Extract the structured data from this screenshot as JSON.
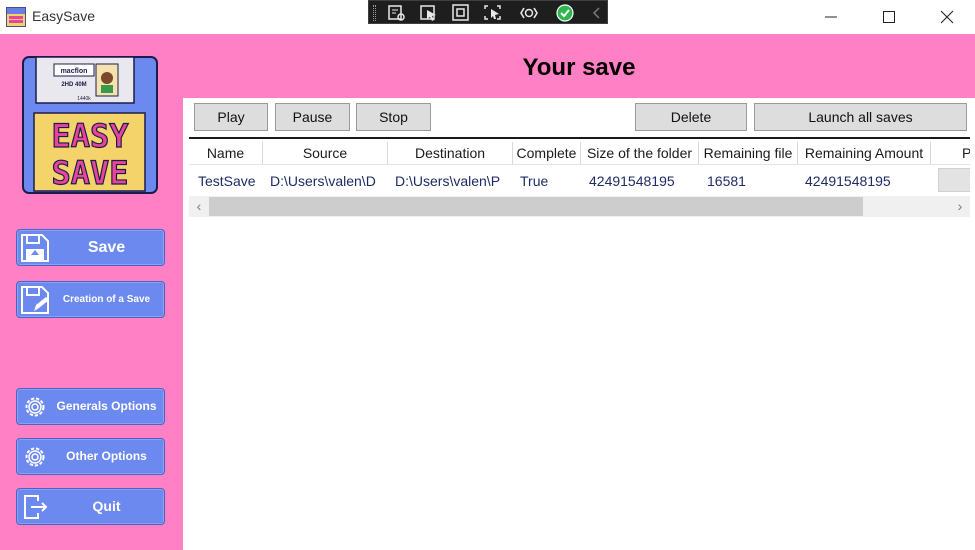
{
  "window": {
    "title": "EasySave"
  },
  "logo": {
    "text_line1": "EASY",
    "text_line2": "SAVE",
    "label_line1": "macflon",
    "label_line2": "2HD 40M",
    "label_line3": "1440k"
  },
  "sidebar": {
    "items": [
      {
        "label": "Save"
      },
      {
        "label": "Creation of a Save"
      },
      {
        "label": "Generals Options"
      },
      {
        "label": "Other Options"
      },
      {
        "label": "Quit"
      }
    ]
  },
  "header": {
    "title": "Your save"
  },
  "toolbar": {
    "play": "Play",
    "pause": "Pause",
    "stop": "Stop",
    "delete": "Delete",
    "launch_all": "Launch all saves"
  },
  "grid": {
    "columns": [
      "Name",
      "Source",
      "Destination",
      "Complete",
      "Size of the folder",
      "Remaining file",
      "Remaining Amount",
      "P"
    ],
    "rows": [
      {
        "name": "TestSave",
        "source": "D:\\Users\\valen\\D",
        "destination": "D:\\Users\\valen\\P",
        "complete": "True",
        "size": "42491548195",
        "remaining_file": "16581",
        "remaining_amount": "42491548195"
      }
    ]
  },
  "scrollbar": {
    "left_arrow": "‹",
    "right_arrow": "›"
  },
  "colors": {
    "sidebar_pink": "#ff80c4",
    "button_blue": "#6b89ef",
    "toolbar_button": "#dddddd",
    "cell_text": "#1f2b66"
  }
}
